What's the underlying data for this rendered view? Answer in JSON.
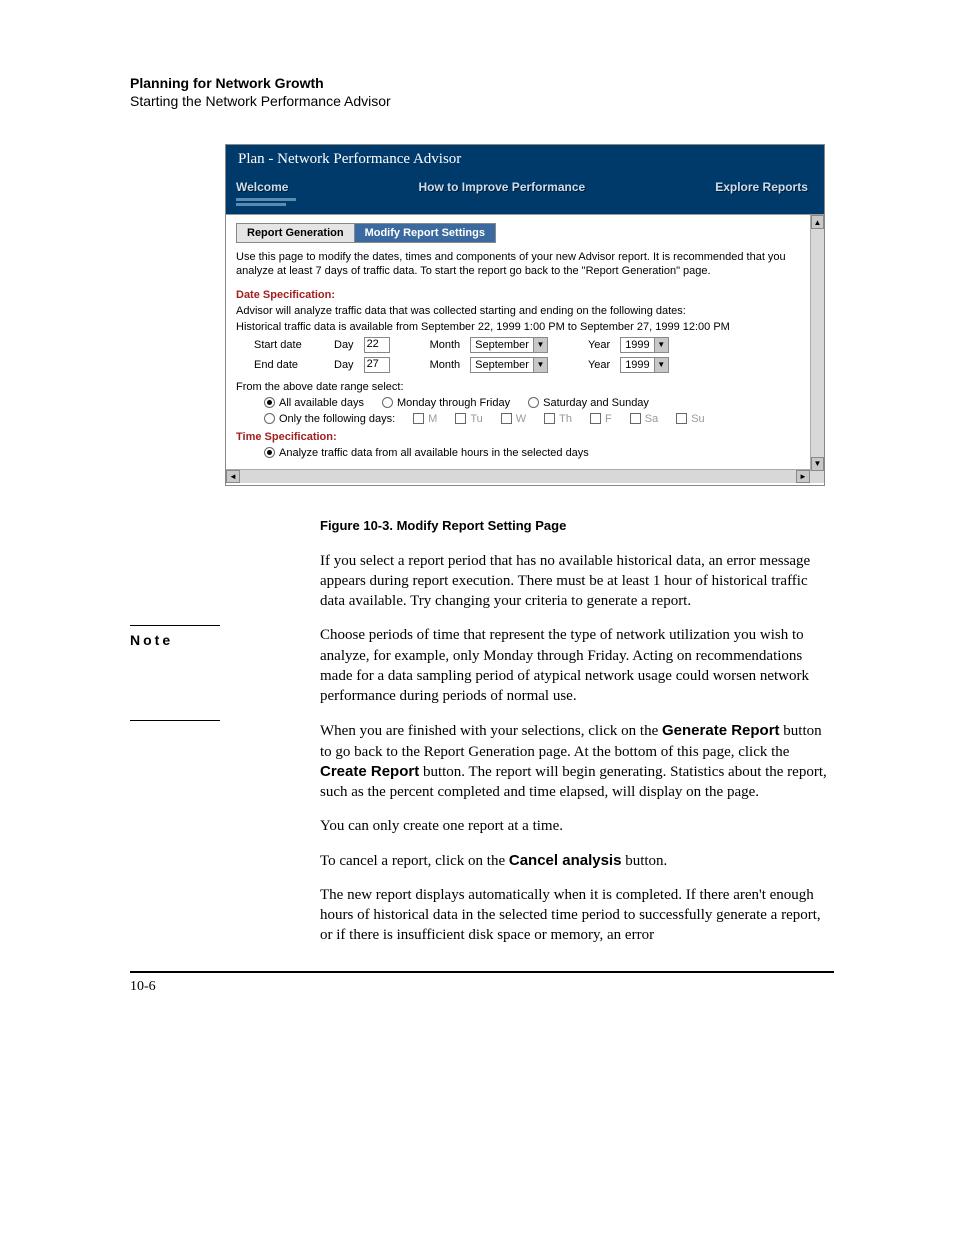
{
  "header": {
    "title": "Planning for Network Growth",
    "subtitle": "Starting the Network Performance Advisor"
  },
  "screenshot": {
    "window_title": "Plan - Network Performance Advisor",
    "nav": {
      "welcome": "Welcome",
      "how_to": "How to Improve Performance",
      "explore": "Explore Reports"
    },
    "subtabs": {
      "report_gen": "Report Generation",
      "modify": "Modify Report Settings"
    },
    "instructions": "Use this page to modify the dates, times and components of your new Advisor report. It is recommended that you analyze at least 7 days of traffic data. To start the report go back to the \"Report Generation\" page.",
    "date_spec_head": "Date Specification:",
    "date_line1": "Advisor will analyze traffic data that was collected starting and ending on the following dates:",
    "date_line2": "Historical traffic data is available from September 22, 1999 1:00 PM to September 27, 1999 12:00 PM",
    "start_label": "Start date",
    "end_label": "End date",
    "day_label": "Day",
    "month_label": "Month",
    "year_label": "Year",
    "start_day": "22",
    "end_day": "27",
    "month_value": "September",
    "year_value": "1999",
    "range_select": "From the above date range select:",
    "radios": {
      "all": "All available days",
      "mf": "Monday through Friday",
      "ss": "Saturday and Sunday",
      "only": "Only the following days:"
    },
    "days": {
      "m": "M",
      "tu": "Tu",
      "w": "W",
      "th": "Th",
      "f": "F",
      "sa": "Sa",
      "su": "Su"
    },
    "time_spec_head": "Time Specification:",
    "time_radio": "Analyze traffic data from all available hours in the selected days"
  },
  "figure_caption": "Figure 10-3.  Modify Report Setting Page",
  "body": {
    "p1": "If you select a report period that has no available historical data, an error message appears during report execution. There must be at least 1 hour of historical traffic data available. Try changing your criteria to generate a report.",
    "note_label": "Note",
    "note_text": "Choose periods of time that represent the type of network utilization you wish to analyze, for example, only Monday through Friday. Acting on recommendations made for a data sampling period of atypical network usage could worsen network performance during periods of normal use.",
    "p3a": "When you are finished with your selections, click on the ",
    "p3b": "Generate Report",
    "p3c": " button to go back to the Report Generation page. At the bottom of this page, click the ",
    "p3d": "Create Report",
    "p3e": " button. The report will begin generating. Statistics about the report, such as the percent completed and time elapsed, will display on the page.",
    "p4": "You can only create one report at a time.",
    "p5a": "To cancel a report, click on the ",
    "p5b": "Cancel analysis",
    "p5c": " button.",
    "p6": "The new report displays automatically when it is completed. If there aren't enough hours of historical data in the selected time period to successfully generate a report, or if there is insufficient disk space or memory, an error"
  },
  "page_number": "10-6"
}
